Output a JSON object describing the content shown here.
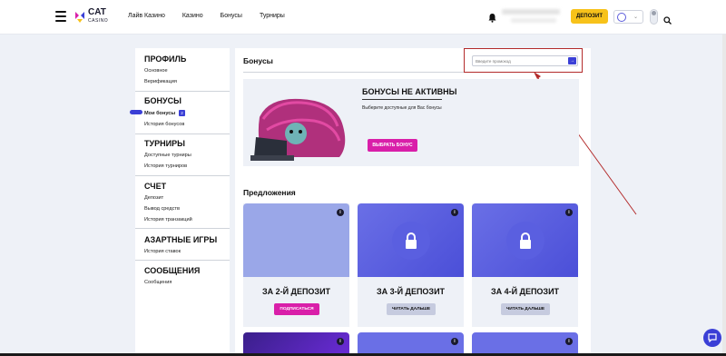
{
  "header": {
    "logo": {
      "title": "CAT",
      "subtitle": "CASINO"
    },
    "nav": [
      "Лайв Казино",
      "Казино",
      "Бонусы",
      "Турниры"
    ],
    "deposit_button": "ДЕПОЗИТ",
    "icons": [
      "menu-icon",
      "bell-icon",
      "globe-icon",
      "chevron-down-icon",
      "search-icon"
    ]
  },
  "sidebar": {
    "sections": [
      {
        "title": "ПРОФИЛЬ",
        "items": [
          "Основное",
          "Верификация"
        ]
      },
      {
        "title": "БОНУСЫ",
        "items": [
          "Мои бонусы",
          "История бонусов"
        ]
      },
      {
        "title": "ТУРНИРЫ",
        "items": [
          "Доступные турниры",
          "История турниров"
        ]
      },
      {
        "title": "СЧЕТ",
        "items": [
          "Депозит",
          "Вывод средств",
          "История транзакций"
        ]
      },
      {
        "title": "АЗАРТНЫЕ ИГРЫ",
        "items": [
          "История ставок"
        ]
      },
      {
        "title": "СООБЩЕНИЯ",
        "items": [
          "Сообщения"
        ]
      }
    ],
    "active_badge": "2"
  },
  "main": {
    "title": "Бонусы",
    "promo": {
      "placeholder": "Введите промокод",
      "submit": "→"
    },
    "inactive": {
      "title": "БОНУСЫ НЕ АКТИВНЫ",
      "subtitle": "Выберите доступные для Вас бонусы",
      "button": "ВЫБРАТЬ БОНУС"
    },
    "offers_title": "Предложения",
    "offers": [
      {
        "title": "ЗА 2-Й ДЕПОЗИТ",
        "button": "ПОДПИСАТЬСЯ",
        "locked": false
      },
      {
        "title": "ЗА 3-Й ДЕПОЗИТ",
        "button": "ЧИТАТЬ ДАЛЬШЕ",
        "locked": true
      },
      {
        "title": "ЗА 4-Й ДЕПОЗИТ",
        "button": "ЧИТАТЬ ДАЛЬШЕ",
        "locked": true
      }
    ],
    "info_glyph": "i"
  },
  "colors": {
    "accent": "#3a3fd6",
    "pink": "#d91fa9",
    "yellow": "#f7c21a",
    "annotation": "#b32b2b"
  }
}
